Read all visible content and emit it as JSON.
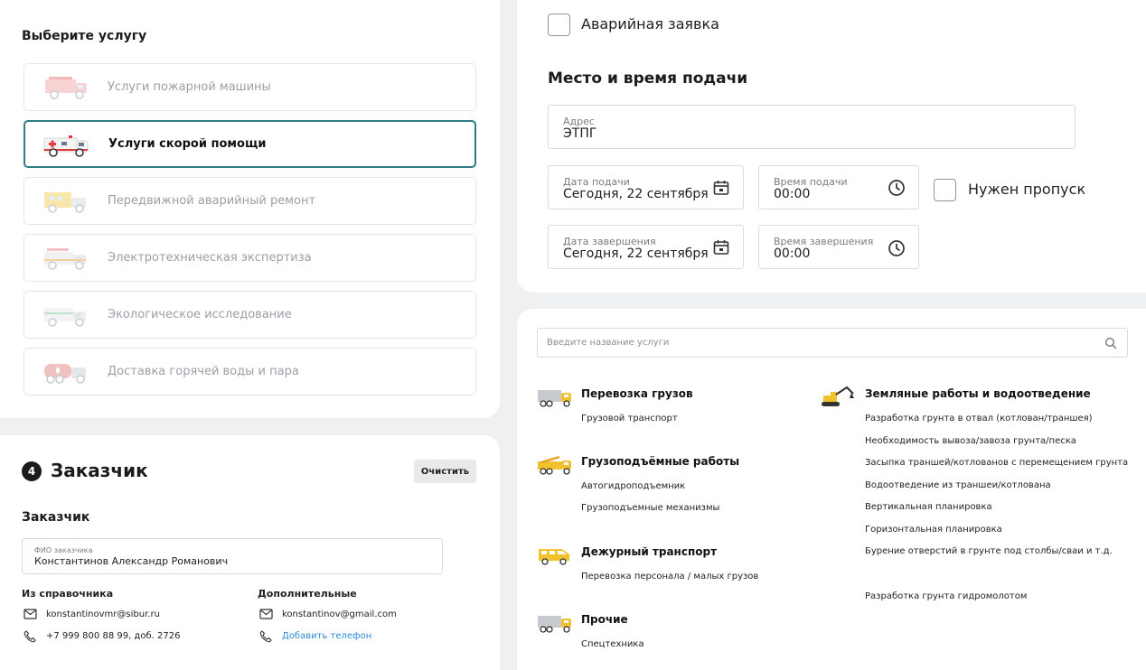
{
  "services": {
    "title": "Выберите услугу",
    "items": [
      {
        "label": "Услуги пожарной машины",
        "icon": "fire-truck-icon"
      },
      {
        "label": "Услуги скорой помощи",
        "icon": "ambulance-icon"
      },
      {
        "label": "Передвижной аварийный ремонт",
        "icon": "repair-van-icon"
      },
      {
        "label": "Электротехническая экспертиза",
        "icon": "electrical-van-icon"
      },
      {
        "label": "Экологическое исследование",
        "icon": "ecology-van-icon"
      },
      {
        "label": "Доставка горячей воды и пара",
        "icon": "water-truck-icon"
      }
    ],
    "active_index": 1
  },
  "customer": {
    "step_number": "4",
    "heading": "Заказчик",
    "clear_label": "Очистить",
    "subheading": "Заказчик",
    "name_caption": "ФИО заказчика",
    "name_value": "Константинов Александр Романович",
    "directory_title": "Из справочника",
    "directory_email": "konstantinovmr@sibur.ru",
    "directory_phone": "+7 999 800 88 99, доб. 2726",
    "extra_title": "Дополнительные",
    "extra_email": "konstantinov@gmail.com",
    "add_phone_label": "Добавить телефон"
  },
  "place": {
    "emergency_label": "Аварийная заявка",
    "heading": "Место и время подачи",
    "address_caption": "Адрес",
    "address_value": "ЭТПГ",
    "start_date_caption": "Дата подачи",
    "start_date_value": "Сегодня, 22 сентября",
    "start_time_caption": "Время подачи",
    "start_time_value": "00:00",
    "pass_label": "Нужен пропуск",
    "end_date_caption": "Дата завершения",
    "end_date_value": "Сегодня, 22 сентября",
    "end_time_caption": "Время завершения",
    "end_time_value": "00:00"
  },
  "catalog": {
    "search_placeholder": "Введите название услуги",
    "left": [
      {
        "title": "Перевозка грузов",
        "icon": "truck-icon",
        "items": [
          "Грузовой транспорт"
        ]
      },
      {
        "title": "Грузоподъёмные работы",
        "icon": "crane-truck-icon",
        "items": [
          "Автогидроподъемник",
          "Грузоподъемные механизмы"
        ]
      },
      {
        "title": "Дежурный транспорт",
        "icon": "van-icon",
        "items": [
          "Перевозка персонала / малых грузов"
        ]
      },
      {
        "title": "Прочие",
        "icon": "truck-icon",
        "items": [
          "Спецтехника"
        ]
      }
    ],
    "right": {
      "title": "Земляные работы и водоотведение",
      "icon": "excavator-icon",
      "items": [
        "Разработка грунта в отвал (котлован/траншея)",
        "Необходимость вывоза/завоза грунта/песка",
        "Засыпка траншей/котлованов с перемещением грунта",
        "Водоотведение из траншеи/котлована",
        "Вертикальная планировка",
        "Горизонтальная планировка",
        "Бурение отверстий в грунте под столбы/сваи и т.д.",
        "Разработка грунта гидромолотом"
      ]
    }
  },
  "colors": {
    "accent": "#2c7d84",
    "link": "#2c8ad3",
    "vehicle_yellow": "#f2c12e"
  }
}
